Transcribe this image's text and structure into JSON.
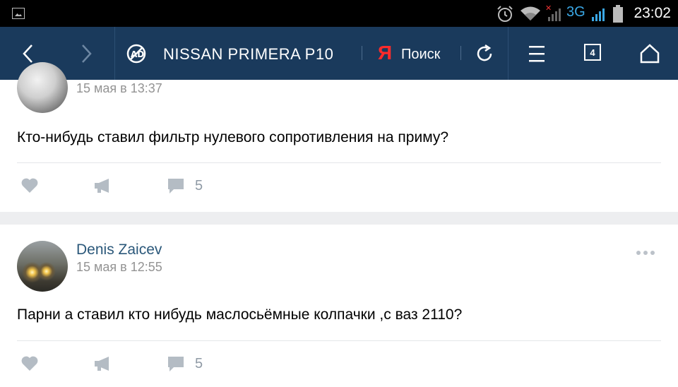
{
  "status_bar": {
    "network": "3G",
    "time": "23:02",
    "icons": [
      "gallery-icon",
      "alarm-icon",
      "wifi-icon",
      "signal-icon",
      "battery-icon"
    ]
  },
  "toolbar": {
    "title": "NISSAN PRIMERA P10",
    "search_logo": "Я",
    "search_label": "Поиск",
    "tab_count": "4"
  },
  "posts": [
    {
      "author": "",
      "date": "15 мая в 13:37",
      "text": "Кто-нибудь ставил фильтр нулевого сопротивления на приму?",
      "comments": "5"
    },
    {
      "author": "Denis Zaicev",
      "date": "15 мая в 12:55",
      "text": "Парни а ставил кто нибудь маслосьёмные колпачки ,с ваз 2110?",
      "comments": "5"
    }
  ],
  "colors": {
    "toolbar_bg": "#1a3a5c",
    "author_link": "#2b587a",
    "yandex_red": "#ff2b2b",
    "action_gray": "#8f9aa5"
  }
}
